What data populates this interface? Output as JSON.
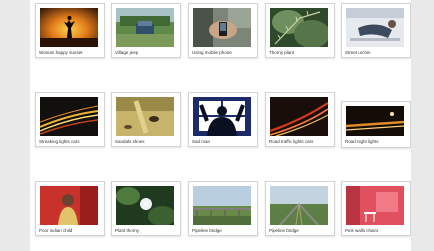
{
  "gallery": {
    "rows": [
      {
        "items": [
          {
            "caption": "Woman happy sunset"
          },
          {
            "caption": "Village jeep"
          },
          {
            "caption": "Using mobile phone"
          },
          {
            "caption": "Thorny plant"
          },
          {
            "caption": "Street urchin"
          }
        ]
      },
      {
        "items": [
          {
            "caption": "Streaking lights cars"
          },
          {
            "caption": "Sandals shoes"
          },
          {
            "caption": "Sad man"
          },
          {
            "caption": "Road traffic lights cars"
          },
          {
            "caption": "Road night lights"
          }
        ]
      },
      {
        "items": [
          {
            "caption": "Poor indian child"
          },
          {
            "caption": "Plant thorny"
          },
          {
            "caption": "Pipeline bridge"
          },
          {
            "caption": "Pipeline bridge"
          },
          {
            "caption": "Pink walls chairs"
          }
        ]
      }
    ]
  }
}
